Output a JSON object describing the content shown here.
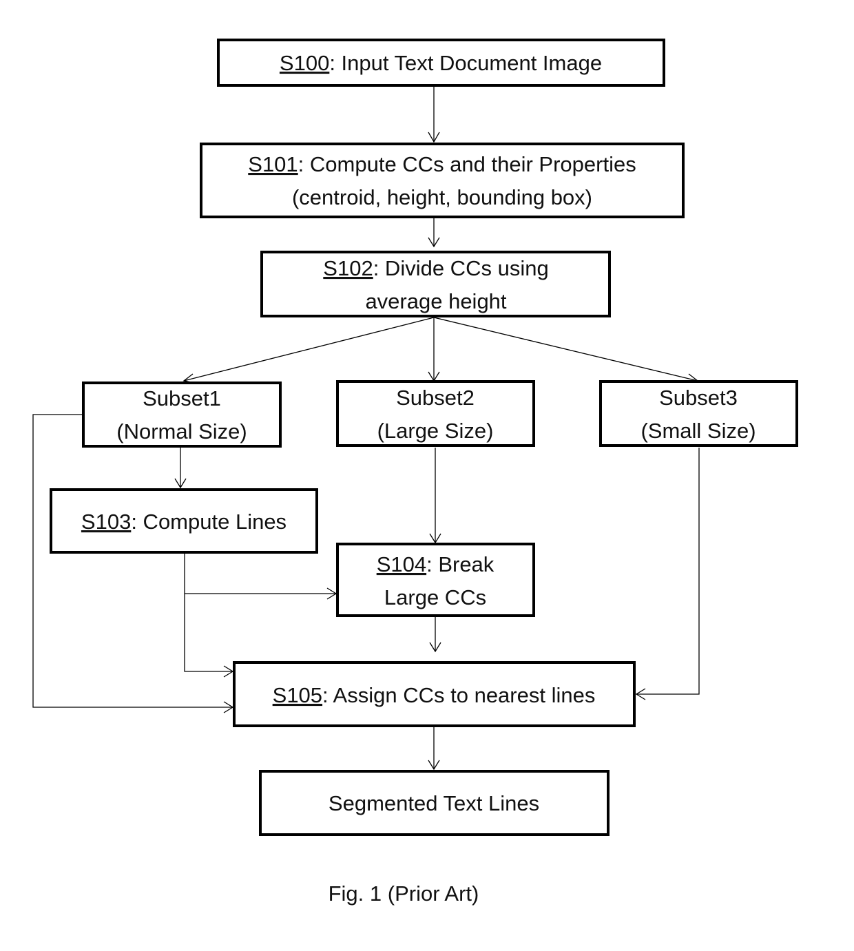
{
  "diagram": {
    "type": "flowchart",
    "caption": "Fig. 1 (Prior Art)",
    "nodes": {
      "s100": {
        "id": "S100",
        "lines": [
          [
            {
              "t": "S100",
              "u": true
            },
            {
              "t": ": Input Text Document Image"
            }
          ]
        ]
      },
      "s101": {
        "id": "S101",
        "lines": [
          [
            {
              "t": "S101",
              "u": true
            },
            {
              "t": ": Compute CCs and their Properties"
            }
          ],
          [
            {
              "t": "(centroid, height, bounding box)"
            }
          ]
        ]
      },
      "s102": {
        "id": "S102",
        "lines": [
          [
            {
              "t": "S102",
              "u": true
            },
            {
              "t": ": Divide CCs using"
            }
          ],
          [
            {
              "t": "average height"
            }
          ]
        ]
      },
      "subset1": {
        "lines": [
          [
            {
              "t": "Subset1"
            }
          ],
          [
            {
              "t": "(Normal Size)"
            }
          ]
        ]
      },
      "subset2": {
        "lines": [
          [
            {
              "t": "Subset2"
            }
          ],
          [
            {
              "t": "(Large Size)"
            }
          ]
        ]
      },
      "subset3": {
        "lines": [
          [
            {
              "t": "Subset3"
            }
          ],
          [
            {
              "t": "(Small Size)"
            }
          ]
        ]
      },
      "s103": {
        "id": "S103",
        "lines": [
          [
            {
              "t": "S103",
              "u": true
            },
            {
              "t": ": Compute Lines"
            }
          ]
        ]
      },
      "s104": {
        "id": "S104",
        "lines": [
          [
            {
              "t": "S104",
              "u": true
            },
            {
              "t": ": Break"
            }
          ],
          [
            {
              "t": "Large CCs"
            }
          ]
        ]
      },
      "s105": {
        "id": "S105",
        "lines": [
          [
            {
              "t": "S105",
              "u": true
            },
            {
              "t": ": Assign CCs to nearest lines"
            }
          ]
        ]
      },
      "output": {
        "lines": [
          [
            {
              "t": "Segmented Text Lines"
            }
          ]
        ]
      }
    },
    "edges": [
      {
        "from": "s100",
        "to": "s101"
      },
      {
        "from": "s101",
        "to": "s102"
      },
      {
        "from": "s102",
        "to": "subset1"
      },
      {
        "from": "s102",
        "to": "subset2"
      },
      {
        "from": "s102",
        "to": "subset3"
      },
      {
        "from": "subset1",
        "to": "s103"
      },
      {
        "from": "subset1",
        "to": "s105"
      },
      {
        "from": "subset2",
        "to": "s104"
      },
      {
        "from": "s103",
        "to": "s104"
      },
      {
        "from": "s103",
        "to": "s105"
      },
      {
        "from": "s104",
        "to": "s105"
      },
      {
        "from": "subset3",
        "to": "s105"
      },
      {
        "from": "s105",
        "to": "output"
      }
    ]
  }
}
